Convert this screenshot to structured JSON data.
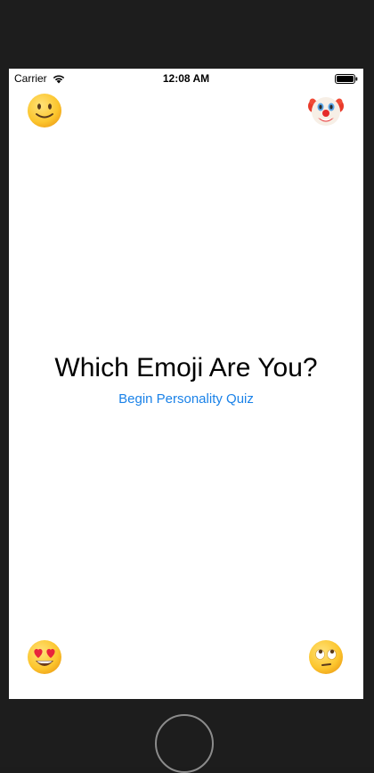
{
  "status_bar": {
    "carrier": "Carrier",
    "time": "12:08 AM",
    "wifi_icon": "wifi-icon",
    "battery_icon": "battery-icon"
  },
  "corner_emojis": {
    "top_left": "slightly-smiling-face-icon",
    "top_right": "clown-face-icon",
    "bottom_left": "heart-eyes-face-icon",
    "bottom_right": "eye-roll-face-icon"
  },
  "main": {
    "title": "Which Emoji Are You?",
    "begin_link": "Begin Personality Quiz"
  },
  "colors": {
    "link": "#1a82e8",
    "frame": "#1d1d1d",
    "screen": "#ffffff",
    "emoji_face": "#ffcc33"
  }
}
